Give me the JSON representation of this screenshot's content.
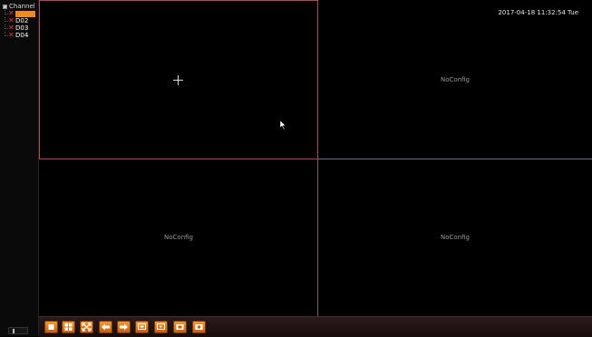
{
  "sidebar": {
    "root_label": "Channel",
    "channels": [
      {
        "label": "",
        "selected": true
      },
      {
        "label": "D02",
        "selected": false
      },
      {
        "label": "D03",
        "selected": false
      },
      {
        "label": "D04",
        "selected": false
      }
    ]
  },
  "grid": {
    "timestamp": "2017-04-18 11:32:54 Tue",
    "panes": [
      {
        "status": ""
      },
      {
        "status": "NoConfig"
      },
      {
        "status": "NoConfig"
      },
      {
        "status": "NoConfig"
      }
    ]
  },
  "toolbar": {
    "buttons": [
      "single-view-icon",
      "quad-view-icon",
      "fullscreen-icon",
      "prev-arrow-icon",
      "next-arrow-icon",
      "record-icon",
      "playback-icon",
      "snapshot-icon",
      "capture-icon"
    ]
  },
  "colors": {
    "accent": "#f08a1e",
    "channel_x": "#e23b2b",
    "selected_border": "#b04a58"
  }
}
